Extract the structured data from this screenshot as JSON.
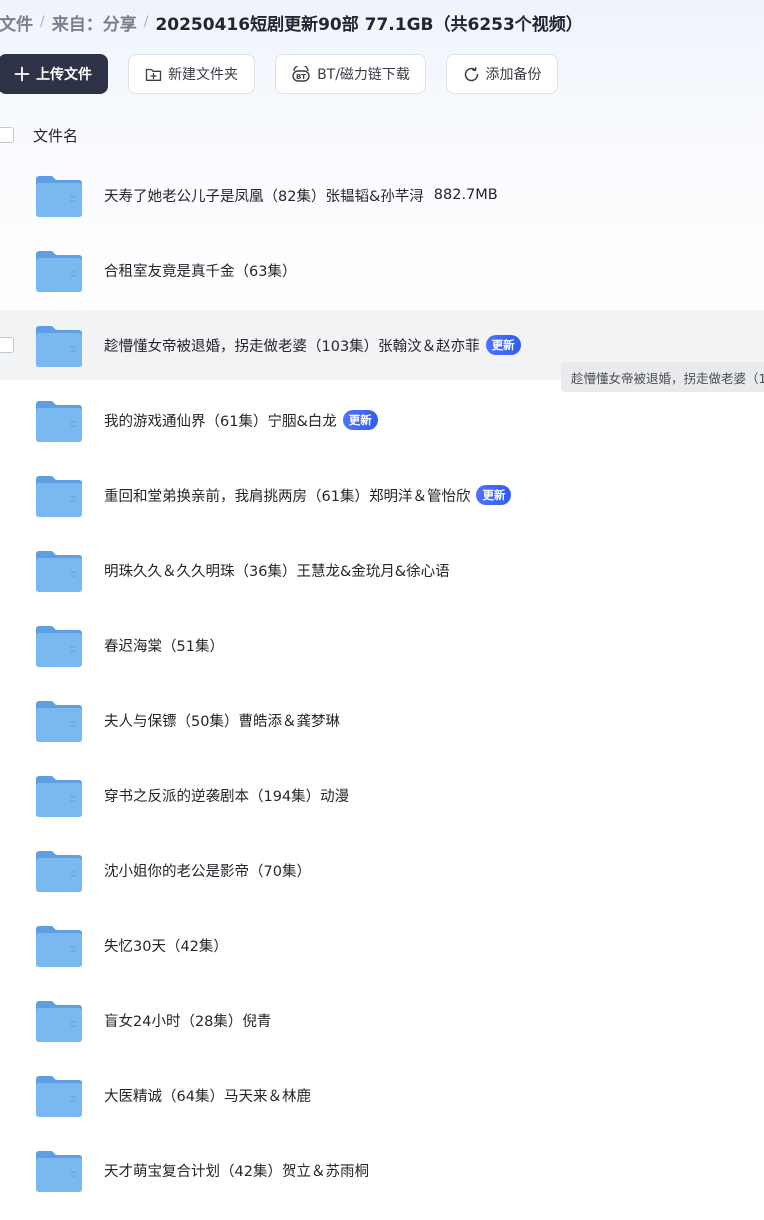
{
  "breadcrumb": {
    "items": [
      "文件",
      "来自：分享"
    ],
    "separator": "/",
    "current": "20250416短剧更新90部 77.1GB（共6253个视频）"
  },
  "toolbar": {
    "upload_label": "上传文件",
    "new_folder_label": "新建文件夹",
    "bt_label": "BT/磁力链下载",
    "backup_label": "添加备份"
  },
  "list": {
    "column_name": "文件名",
    "rows": [
      {
        "name": "天寿了她老公儿子是凤凰（82集）张韫韬&孙芊浔",
        "size": "882.7MB",
        "badge": ""
      },
      {
        "name": "合租室友竟是真千金（63集）",
        "size": "",
        "badge": ""
      },
      {
        "name": "趁懵懂女帝被退婚，拐走做老婆（103集）张翰汶＆赵亦菲",
        "size": "",
        "badge": "更新"
      },
      {
        "name": "我的游戏通仙界（61集）宁胭&白龙",
        "size": "",
        "badge": "更新"
      },
      {
        "name": "重回和堂弟换亲前，我肩挑两房（61集）郑明洋＆管怡欣",
        "size": "",
        "badge": "更新"
      },
      {
        "name": "明珠久久＆久久明珠（36集）王慧龙&金玧月&徐心语",
        "size": "",
        "badge": ""
      },
      {
        "name": "春迟海棠（51集）",
        "size": "",
        "badge": ""
      },
      {
        "name": "夫人与保镖（50集）曹皓添＆龚梦琳",
        "size": "",
        "badge": ""
      },
      {
        "name": "穿书之反派的逆袭剧本（194集）动漫",
        "size": "",
        "badge": ""
      },
      {
        "name": "沈小姐你的老公是影帝（70集）",
        "size": "",
        "badge": ""
      },
      {
        "name": "失忆30天（42集）",
        "size": "",
        "badge": ""
      },
      {
        "name": "盲女24小时（28集）倪青",
        "size": "",
        "badge": ""
      },
      {
        "name": "大医精诚（64集）马天来＆林鹿",
        "size": "",
        "badge": ""
      },
      {
        "name": "天才萌宝复合计划（42集）贺立＆苏雨桐",
        "size": "",
        "badge": ""
      }
    ]
  },
  "tooltip": {
    "text": "趁懵懂女帝被退婚，拐走做老婆（1"
  },
  "colors": {
    "primary_button": "#2e3247",
    "badge": "#3b63f5",
    "folder": "#6fb0ea",
    "hover_row": "#f2f3f5"
  },
  "icons": {
    "upload": "plus-icon",
    "new_folder": "folder-plus-icon",
    "bt": "bt-icon",
    "backup": "sync-icon",
    "row": "folder-icon"
  }
}
